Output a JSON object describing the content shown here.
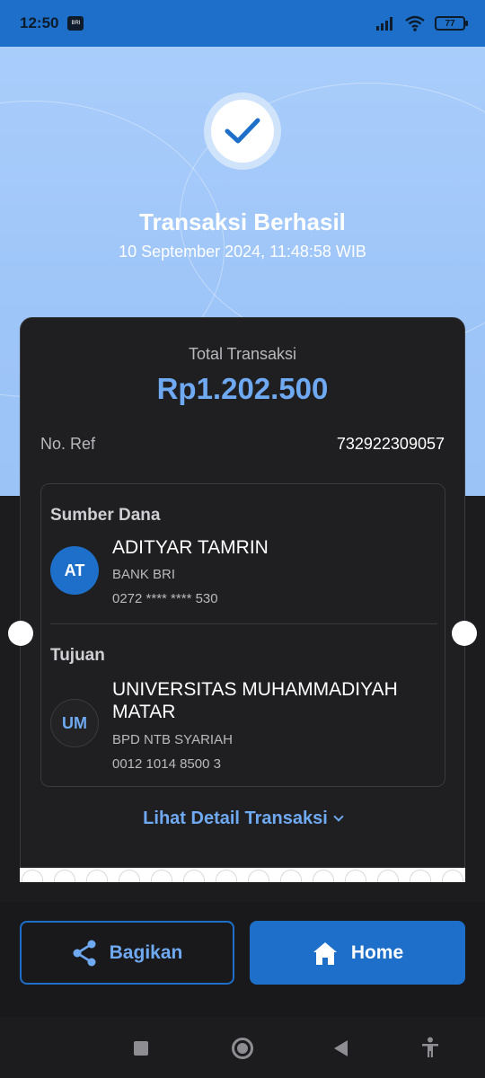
{
  "status_bar": {
    "time": "12:50",
    "chip_label": "BRI",
    "battery": "77"
  },
  "header": {
    "title": "Transaksi Berhasil",
    "datetime": "10 September 2024, 11:48:58 WIB"
  },
  "summary": {
    "total_label": "Total Transaksi",
    "total_amount": "Rp1.202.500",
    "ref_label": "No. Ref",
    "ref_value": "732922309057"
  },
  "source": {
    "section_label": "Sumber Dana",
    "initials": "AT",
    "name": "ADITYAR TAMRIN",
    "bank": "BANK BRI",
    "account": "0272 **** **** 530"
  },
  "destination": {
    "section_label": "Tujuan",
    "initials": "UM",
    "name_line1": "UNIVERSITAS MUHAMMADIYAH",
    "name_line2": "MATAR",
    "bank": "BPD NTB SYARIAH",
    "account": "0012 1014 8500 3"
  },
  "detail_link": "Lihat Detail Transaksi",
  "actions": {
    "share_label": "Bagikan",
    "home_label": "Home"
  },
  "icons": {
    "check": "check-icon",
    "share": "share-icon",
    "home": "home-icon",
    "chevron": "chevron-down-icon"
  },
  "colors": {
    "accent": "#1d6fc9",
    "accent_light": "#6fa9f2",
    "hero_bg": "#a9cdfb",
    "card_bg": "#1f1f21"
  }
}
